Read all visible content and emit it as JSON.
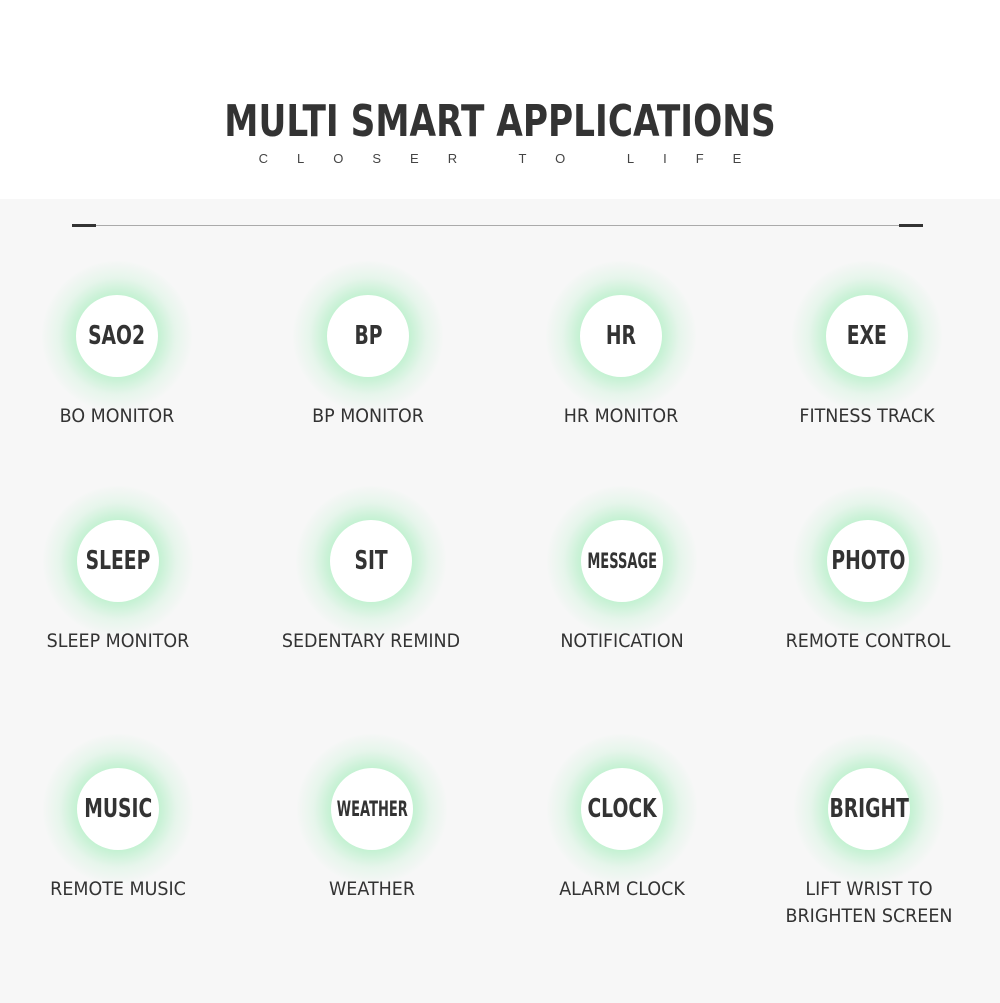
{
  "header": {
    "title": "MULTI SMART APPLICATIONS",
    "subtitle": "CLOSER TO LIFE"
  },
  "features": [
    {
      "icon_text": "SAO2",
      "label": "BO MONITOR"
    },
    {
      "icon_text": "BP",
      "label": "BP MONITOR"
    },
    {
      "icon_text": "HR",
      "label": "HR MONITOR"
    },
    {
      "icon_text": "EXE",
      "label": "FITNESS TRACK"
    },
    {
      "icon_text": "SLEEP",
      "label": "SLEEP MONITOR"
    },
    {
      "icon_text": "SIT",
      "label": "SEDENTARY REMIND"
    },
    {
      "icon_text": "MESSAGE",
      "label": "NOTIFICATION"
    },
    {
      "icon_text": "PHOTO",
      "label": "REMOTE CONTROL"
    },
    {
      "icon_text": "MUSIC",
      "label": "REMOTE MUSIC"
    },
    {
      "icon_text": "WEATHER",
      "label": "WEATHER"
    },
    {
      "icon_text": "CLOCK",
      "label": "ALARM CLOCK"
    },
    {
      "icon_text": "BRIGHT",
      "label": "LIFT WRIST TO BRIGHTEN SCREEN"
    }
  ],
  "colors": {
    "glow": "#8cebaa",
    "text": "#333333",
    "background": "#f7f7f7"
  }
}
